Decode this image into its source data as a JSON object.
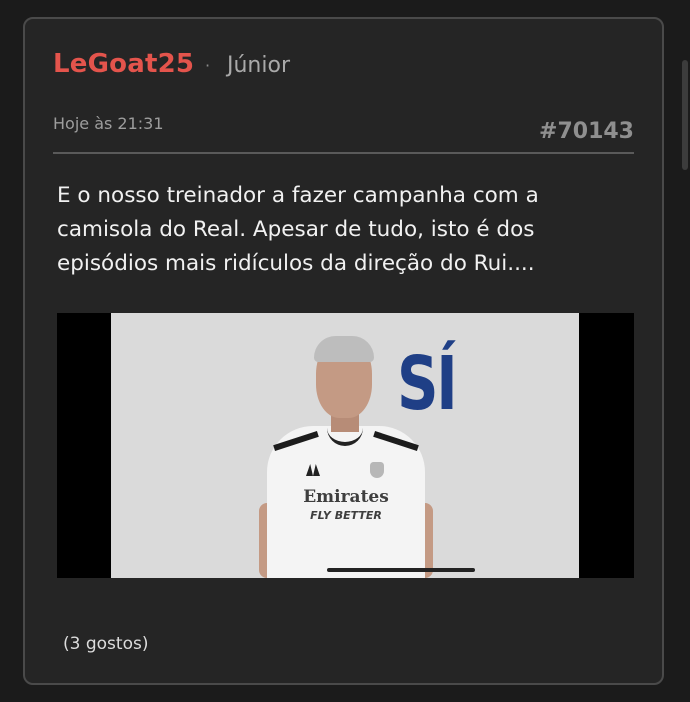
{
  "post": {
    "username": "LeGoat25",
    "separator": "·",
    "user_title": "Júnior",
    "timestamp": "Hoje às 21:31",
    "post_number": "#70143",
    "body": "E o nosso treinador a fazer campanha com a camisola do Real. Apesar de tudo, isto é dos episódios mais ridículos da direção do Rui....",
    "media": {
      "overlay_text": "SÍ",
      "sponsor_text": "Emirates",
      "sponsor_tagline": "FLY BETTER"
    },
    "likes_text": "(3 gostos)"
  },
  "colors": {
    "background": "#1b1b1b",
    "card": "#252525",
    "accent": "#e4544c",
    "text": "#f1f1f1"
  }
}
